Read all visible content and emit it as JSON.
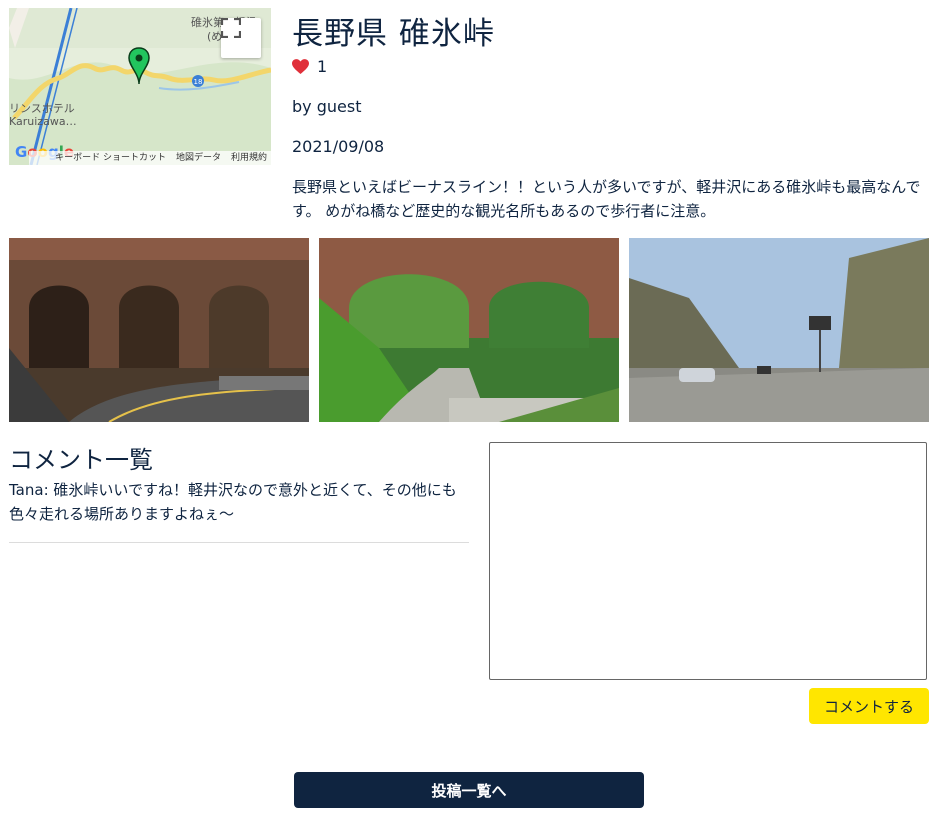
{
  "post": {
    "title": "長野県 碓氷峠",
    "likes": "1",
    "author": "by guest",
    "date": "2021/09/08",
    "body": "長野県といえばビーナスライン！！という人が多いですが、軽井沢にある碓氷峠も最高なんです。 めがね橋など歴史的な観光名所もあるので歩行者に注意。"
  },
  "map": {
    "label_top": "碓氷第三橋梁",
    "label_top2": "(めがね橋)",
    "label_hotel": "リンスホテル",
    "label_karuizawa": "Karuizawa…",
    "route_number": "18",
    "logo": "Google",
    "footer": [
      "キーボード ショートカット",
      "地図データ",
      "利用規約"
    ]
  },
  "photos": [
    {
      "alt": "めがね橋 (道路から)"
    },
    {
      "alt": "めがね橋 (遊歩道から)"
    },
    {
      "alt": "碓氷峠の道路"
    }
  ],
  "comments": {
    "title": "コメント一覧",
    "items": [
      {
        "text": "Tana: 碓氷峠いいですね！軽井沢なので意外と近くて、その他にも色々走れる場所ありますよねぇ〜"
      }
    ]
  },
  "form": {
    "textarea_value": "",
    "submit_label": "コメントする"
  },
  "nav": {
    "back_label": "投稿一覧へ"
  },
  "colors": {
    "text": "#0f2440",
    "heart": "#e0303a",
    "submit_bg": "#ffe600",
    "back_bg": "#0f2440"
  }
}
